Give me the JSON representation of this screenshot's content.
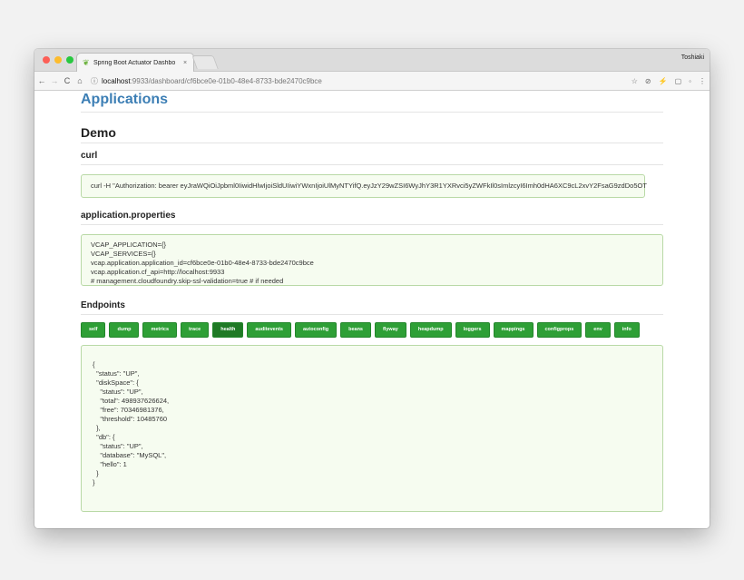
{
  "browser": {
    "tab_title": "Spring Boot Actuator Dashbo",
    "tab_close": "×",
    "profile": "Toshiaki",
    "url_host": "localhost",
    "url_path": ":9933/dashboard/cf6bce0e-01b0-48e4-8733-bde2470c9bce"
  },
  "page": {
    "title": "Applications",
    "app_name": "Demo",
    "curl_title": "curl",
    "curl_command": "curl -H \"Authorization: bearer eyJraWQiOiJpbml0IiwidHlwIjoiSldUIiwiYWxnIjoiUlMyNTYifQ.eyJzY29wZSI6WyJhY3R1YXRvci5yZWFkIl0sImlzcyI6Imh0dHA6XC9cL2xvY2FsaG9zdDo5OT",
    "props_title": "application.properties",
    "props_lines": [
      "VCAP_APPLICATION={}",
      "VCAP_SERVICES={}",
      "vcap.application.application_id=cf6bce0e-01b0-48e4-8733-bde2470c9bce",
      "vcap.application.cf_api=http://localhost:9933",
      "# management.cloudfoundry.skip-ssl-validation=true # if needed"
    ],
    "endpoints_title": "Endpoints",
    "endpoints": [
      "self",
      "dump",
      "metrics",
      "trace",
      "health",
      "auditevents",
      "autoconfig",
      "beans",
      "flyway",
      "heapdump",
      "loggers",
      "mappings",
      "configprops",
      "env",
      "info"
    ],
    "active_endpoint": "health",
    "json_output": "{\n  \"status\": \"UP\",\n  \"diskSpace\": {\n    \"status\": \"UP\",\n    \"total\": 498937626624,\n    \"free\": 70346981376,\n    \"threshold\": 10485760\n  },\n  \"db\": {\n    \"status\": \"UP\",\n    \"database\": \"MySQL\",\n    \"hello\": 1\n  }\n}"
  },
  "colors": {
    "title": "#3d7fb5",
    "button": "#2e9f36",
    "box_bg": "#f6fcf0",
    "box_border": "#b9d9a6"
  }
}
